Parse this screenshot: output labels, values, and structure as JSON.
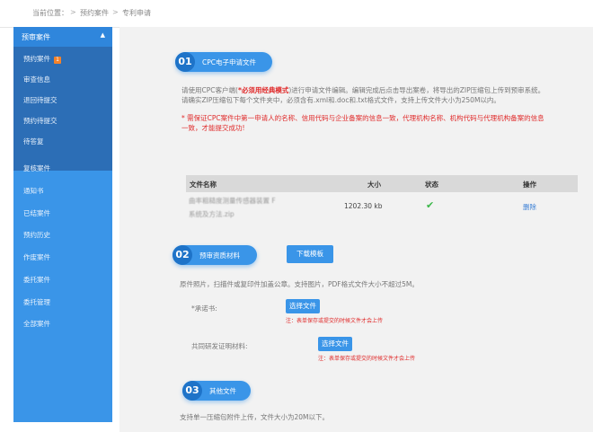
{
  "breadcrumb": {
    "prefix": "当前位置：",
    "sep": ">",
    "crumb1": "预约案件",
    "crumb2": "专利申请"
  },
  "sidebar": {
    "header": "预审案件",
    "caret": "▲",
    "sub_items": [
      {
        "label": "预约案件",
        "badge": "1"
      },
      {
        "label": "审查信息"
      },
      {
        "label": "退回待提交"
      },
      {
        "label": "预约待提交"
      },
      {
        "label": "待答复"
      }
    ],
    "items": [
      {
        "label": "复核案件"
      },
      {
        "label": "通知书"
      },
      {
        "label": "已结案件"
      },
      {
        "label": "预约历史"
      },
      {
        "label": "作废案件"
      },
      {
        "label": "委托案件"
      },
      {
        "label": "委托管理"
      },
      {
        "label": "全部案件"
      }
    ]
  },
  "section1": {
    "num": "01",
    "title": "CPC电子申请文件",
    "line1_a": "请使用CPC客户端(",
    "line1_b": "*必须用经典模式",
    "line1_c": ")进行申请文件编辑。编辑完成后点击导出案卷，将导出的ZIP压缩包上传到预审系统。",
    "line2": "请确实ZIP压缩包下每个文件夹中，必须含有.xml和.doc和.txt格式文件，支持上传文件大小为250M以内。",
    "warn1": "* 需保证CPC案件中第一申请人的名称、信用代码与企业备案的信息一致，代理机构名称、机构代码与代理机构备案的信息",
    "warn2": "一致，才能提交成功!"
  },
  "file_table": {
    "headers": {
      "name": "文件名称",
      "size": "大小",
      "status": "状态",
      "action": "操作"
    },
    "rows": [
      {
        "name_line1": "曲率粗糙度测量传感器装置 F",
        "name_line2": "系统及方法.zip",
        "size": "1202.30 kb",
        "status": "✔",
        "action": "删除"
      }
    ]
  },
  "section2": {
    "num": "02",
    "title": "预审资质材料",
    "download_btn": "下载模板",
    "desc": "原件照片，扫描件或复印件加盖公章。支持图片，PDF格式文件大小不超过5M。",
    "fields": [
      {
        "label": "*承诺书:",
        "btn": "选择文件",
        "note": "注：表单保存或提交的时候文件才会上传"
      },
      {
        "label": "共同研发证明材料:",
        "btn": "选择文件",
        "note": "注：表单保存或提交的时候文件才会上传"
      }
    ]
  },
  "section3": {
    "num": "03",
    "title": "其他文件",
    "desc": "支持单一压缩包附件上传，文件大小为20M以下。"
  },
  "colors": {
    "sidebar": "#3a95e8",
    "sidebar_active": "#2c6eb6",
    "accent": "#3a95e8",
    "warn": "#e02b2b",
    "ok": "#3cb84a"
  }
}
